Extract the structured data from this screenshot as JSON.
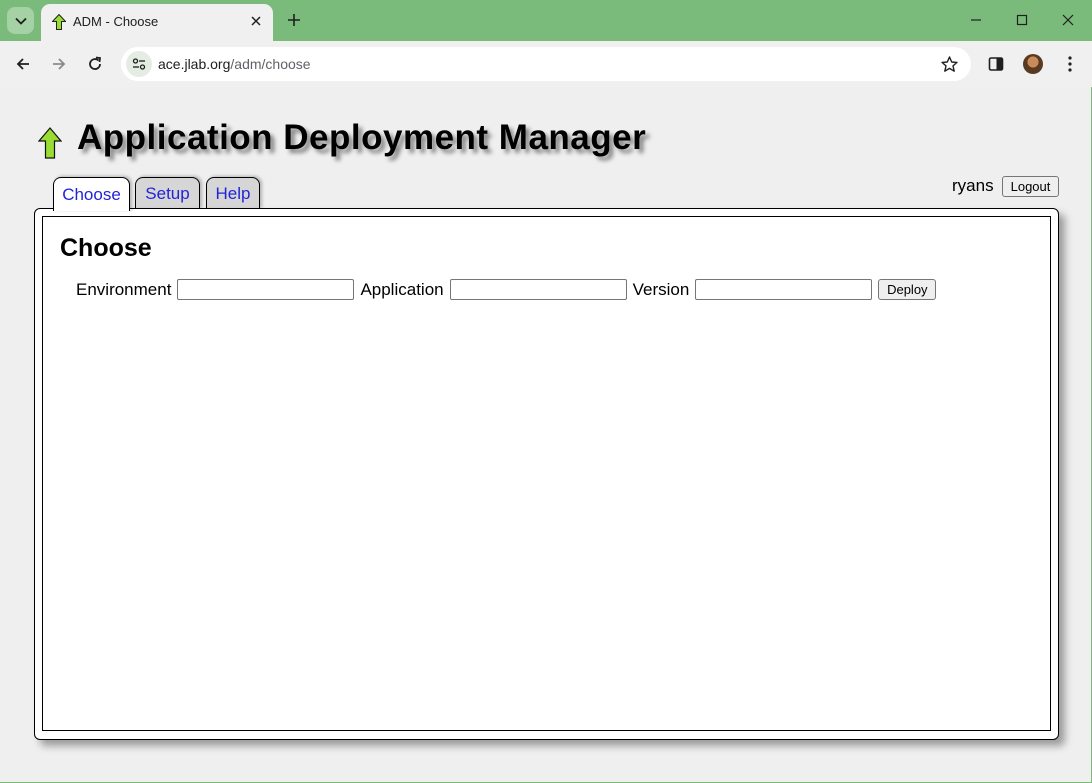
{
  "browser": {
    "tab_title": "ADM - Choose",
    "url_host": "ace.jlab.org",
    "url_path": "/adm/choose",
    "icons": [
      "tab-search-icon",
      "close-icon",
      "plus-icon",
      "minimize-icon",
      "maximize-icon",
      "close-window-icon",
      "back-icon",
      "forward-icon",
      "reload-icon",
      "site-info-icon",
      "star-icon",
      "side-panel-icon",
      "menu-icon"
    ]
  },
  "app": {
    "title": "Application Deployment Manager",
    "logo_icon": "up-arrow-icon",
    "accent_color": "#99dd33"
  },
  "tabs": [
    {
      "label": "Choose",
      "active": true
    },
    {
      "label": "Setup",
      "active": false
    },
    {
      "label": "Help",
      "active": false
    }
  ],
  "user": {
    "name": "ryans",
    "logout_label": "Logout"
  },
  "main": {
    "heading": "Choose",
    "environment_label": "Environment",
    "environment_value": "",
    "application_label": "Application",
    "application_value": "",
    "version_label": "Version",
    "version_value": "",
    "deploy_label": "Deploy"
  }
}
